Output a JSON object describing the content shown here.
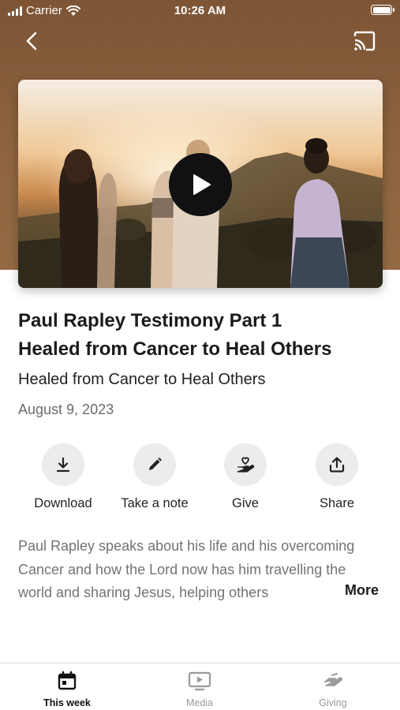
{
  "status_bar": {
    "carrier": "Carrier",
    "time": "10:26 AM"
  },
  "header": {
    "back_icon": "chevron-left-icon",
    "cast_icon": "cast-icon"
  },
  "video": {
    "play_icon": "play-icon"
  },
  "content": {
    "title_line1": "Paul Rapley Testimony Part 1",
    "title_line2": "Healed from Cancer to Heal Others",
    "subtitle": "Healed from Cancer to Heal Others",
    "date": "August 9, 2023"
  },
  "actions": [
    {
      "label": "Download",
      "icon": "download-icon"
    },
    {
      "label": "Take a note",
      "icon": "pencil-icon"
    },
    {
      "label": "Give",
      "icon": "give-heart-hand-icon"
    },
    {
      "label": "Share",
      "icon": "share-icon"
    }
  ],
  "description": {
    "text": "Paul Rapley speaks about his life and his overcoming Cancer and how the Lord now has him travelling the world and sharing Jesus, helping others",
    "more_label": "More"
  },
  "tabbar": [
    {
      "label": "This week",
      "icon": "calendar-icon",
      "active": true
    },
    {
      "label": "Media",
      "icon": "media-icon",
      "active": false
    },
    {
      "label": "Giving",
      "icon": "giving-icon",
      "active": false
    }
  ],
  "colors": {
    "header_brown": "#8f6440",
    "action_circle": "#ececec",
    "text_dark": "#1b1b1b",
    "text_muted": "#737373",
    "tab_inactive": "#9a9a9a"
  }
}
